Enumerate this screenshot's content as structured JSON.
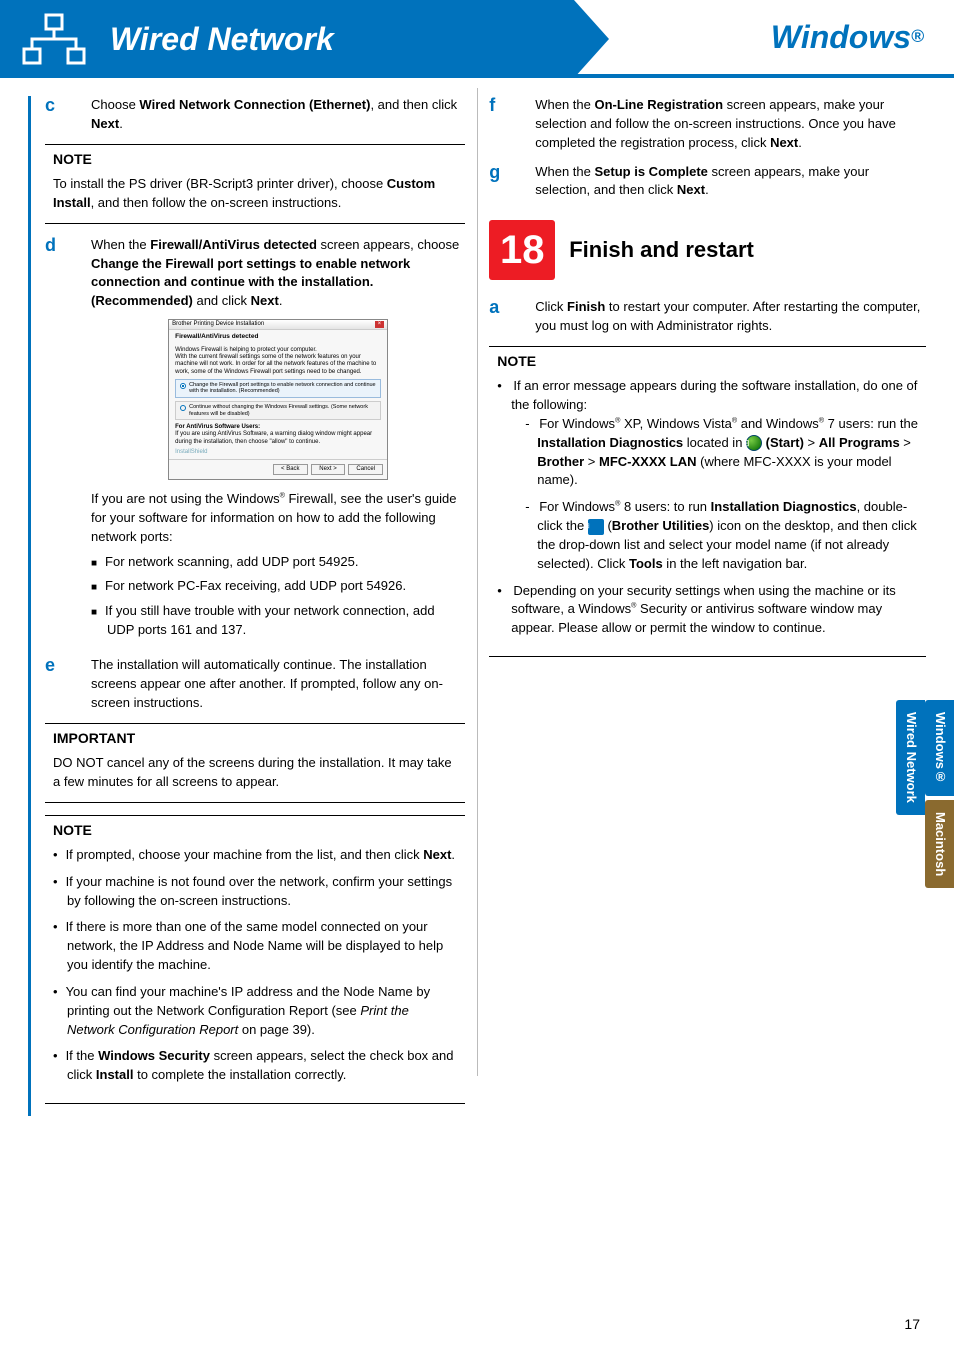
{
  "header": {
    "left_title": "Wired Network",
    "right_title_base": "Windows",
    "right_title_sup": "®"
  },
  "left_col": {
    "step_c": {
      "letter": "c",
      "pre": "Choose ",
      "bold1": "Wired Network Connection (Ethernet)",
      "mid": ", and then click ",
      "bold2": "Next",
      "post": "."
    },
    "note1": {
      "heading": "NOTE",
      "pre": "To install the PS driver (BR-Script3 printer driver), choose ",
      "bold": "Custom Install",
      "post": ", and then follow the on-screen instructions."
    },
    "step_d": {
      "letter": "d",
      "t1": "When the ",
      "b1": "Firewall/AntiVirus detected",
      "t2": " screen appears, choose ",
      "b2": "Change the Firewall port settings to enable network connection and continue with the installation. (Recommended)",
      "t3": " and click ",
      "b3": "Next",
      "t4": "."
    },
    "dialog": {
      "title": "Brother Printing Device Installation",
      "heading": "Firewall/AntiVirus detected",
      "line1": "Windows Firewall is helping to protect your computer.",
      "line2": "With the current firewall settings some of the network features on your machine will not work. In order for all the network features of the machine to work, some of the Windows Firewall port settings need to be changed.",
      "opt1": "Change the Firewall port settings to enable network connection and continue with the installation. (Recommended)",
      "opt2": "Continue without changing the Windows Firewall settings. (Some network features will be disabled)",
      "av_head": "For AntiVirus Software Users:",
      "av_body": "If you are using AntiVirus Software, a warning dialog window might appear during the installation, then choose \"allow\" to continue.",
      "broadcast": "InstallShield",
      "btn_back": "< Back",
      "btn_next": "Next >",
      "btn_cancel": "Cancel"
    },
    "after_dialog": {
      "p1a": "If you are not using the Windows",
      "p1sup": "®",
      "p1b": " Firewall, see the user's guide for your software for information on how to add the following network ports:",
      "li1": "For network scanning, add UDP port 54925.",
      "li2": "For network PC-Fax receiving, add UDP port 54926.",
      "li3": "If you still have trouble with your network connection, add UDP ports 161 and 137."
    },
    "step_e": {
      "letter": "e",
      "text": "The installation will automatically continue. The installation screens appear one after another. If prompted, follow any on-screen instructions."
    },
    "important": {
      "heading": "IMPORTANT",
      "text": "DO NOT cancel any of the screens during the installation. It may take a few minutes for all screens to appear."
    },
    "note2": {
      "heading": "NOTE",
      "li1_a": "If prompted, choose your machine from the list, and then click ",
      "li1_b": "Next",
      "li1_c": ".",
      "li2": "If your machine is not found over the network, confirm your settings by following the on-screen instructions.",
      "li3": "If there is more than one of the same model connected on your network, the IP Address and Node Name will be displayed to help you identify the machine.",
      "li4_a": "You can find your machine's IP address and the Node Name by printing out the Network Configuration Report (see ",
      "li4_i": "Print the Network Configuration Report",
      "li4_b": " on page 39).",
      "li5_a": "If the ",
      "li5_b1": "Windows Security",
      "li5_b": " screen appears, select the check box and click ",
      "li5_b2": "Install",
      "li5_c": " to complete the installation correctly."
    }
  },
  "right_col": {
    "step_f": {
      "letter": "f",
      "t1": "When the ",
      "b1": "On-Line Registration",
      "t2": " screen appears, make your selection and follow the on-screen instructions. Once you have completed the registration process, click ",
      "b2": "Next",
      "t3": "."
    },
    "step_g": {
      "letter": "g",
      "t1": "When the ",
      "b1": "Setup is Complete",
      "t2": " screen appears, make your selection, and then click ",
      "b2": "Next",
      "t3": "."
    },
    "step18": {
      "num": "18",
      "title": "Finish and restart"
    },
    "step_a": {
      "letter": "a",
      "t1": "Click ",
      "b1": "Finish",
      "t2": " to restart your computer. After restarting the computer, you must log on with Administrator rights."
    },
    "note": {
      "heading": "NOTE",
      "li1": "If an error message appears during the software installation, do one of the following:",
      "d1_a": "For Windows",
      "sup": "®",
      "d1_b": " XP, Windows Vista",
      "d1_c": " and Windows",
      "d1_d": " 7 users: run the ",
      "d1_bold1": "Installation Diagnostics",
      "d1_e": " located in ",
      "d1_bold2": "(Start)",
      "d1_f": " > ",
      "d1_bold3": "All Programs",
      "d1_bold4": "Brother",
      "d1_bold5": "MFC-XXXX LAN",
      "d1_g": " (where MFC-XXXX is your model name).",
      "d2_a": "For Windows",
      "d2_b": " 8 users: to run ",
      "d2_bold1": "Installation Diagnostics",
      "d2_c": ", double-click the ",
      "d2_paren1": "(",
      "d2_bold2": "Brother Utilities",
      "d2_paren2": ")",
      "d2_d": " icon on the desktop, and then click the drop-down list and select your model name (if not already selected). Click ",
      "d2_bold3": "Tools",
      "d2_e": " in the left navigation bar.",
      "li2_a": "Depending on your security settings when using the machine or its software, a Windows",
      "li2_b": " Security or antivirus software window may appear. Please allow or permit the window to continue."
    }
  },
  "tabs": {
    "wired": "Wired Network",
    "win": "Windows®",
    "mac": "Macintosh"
  },
  "page_number": "17"
}
